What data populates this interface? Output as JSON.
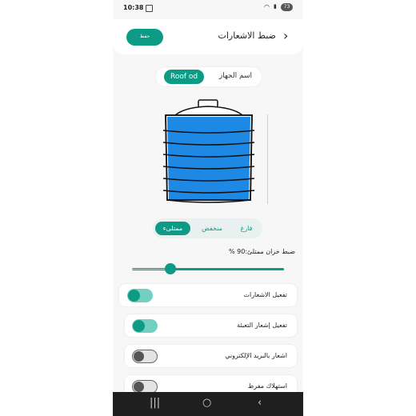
{
  "status_bar": {
    "time": "10:38",
    "battery": "73"
  },
  "header": {
    "title": "ضبط الاشعارات",
    "save_label": "حفظ"
  },
  "device": {
    "label": "اسم الجهاز",
    "value": "Roof od"
  },
  "level_segment": {
    "options": [
      "ممتلىء",
      "منخفض",
      "فارغ"
    ],
    "selected": "ممتلىء"
  },
  "full_tank_slider": {
    "label": "ضبط خزان ممتلئ:90 %",
    "value_percent": 90
  },
  "settings": [
    {
      "label": "تفعيل الاشعارات",
      "enabled": true
    },
    {
      "label": "تفعيل إشعار التعبئة",
      "enabled": true
    },
    {
      "label": "اشعار بالبريد الإلكتروني",
      "enabled": false
    },
    {
      "label": "استهلاك مفرط",
      "enabled": false
    }
  ],
  "colors": {
    "accent": "#0d9b86",
    "tank_blue": "#1e88e5",
    "toggle_on_track": "#74cfc3"
  },
  "icons": {
    "back": "chevron-right-icon",
    "nav": [
      "recents-icon",
      "home-icon",
      "back-icon"
    ]
  }
}
